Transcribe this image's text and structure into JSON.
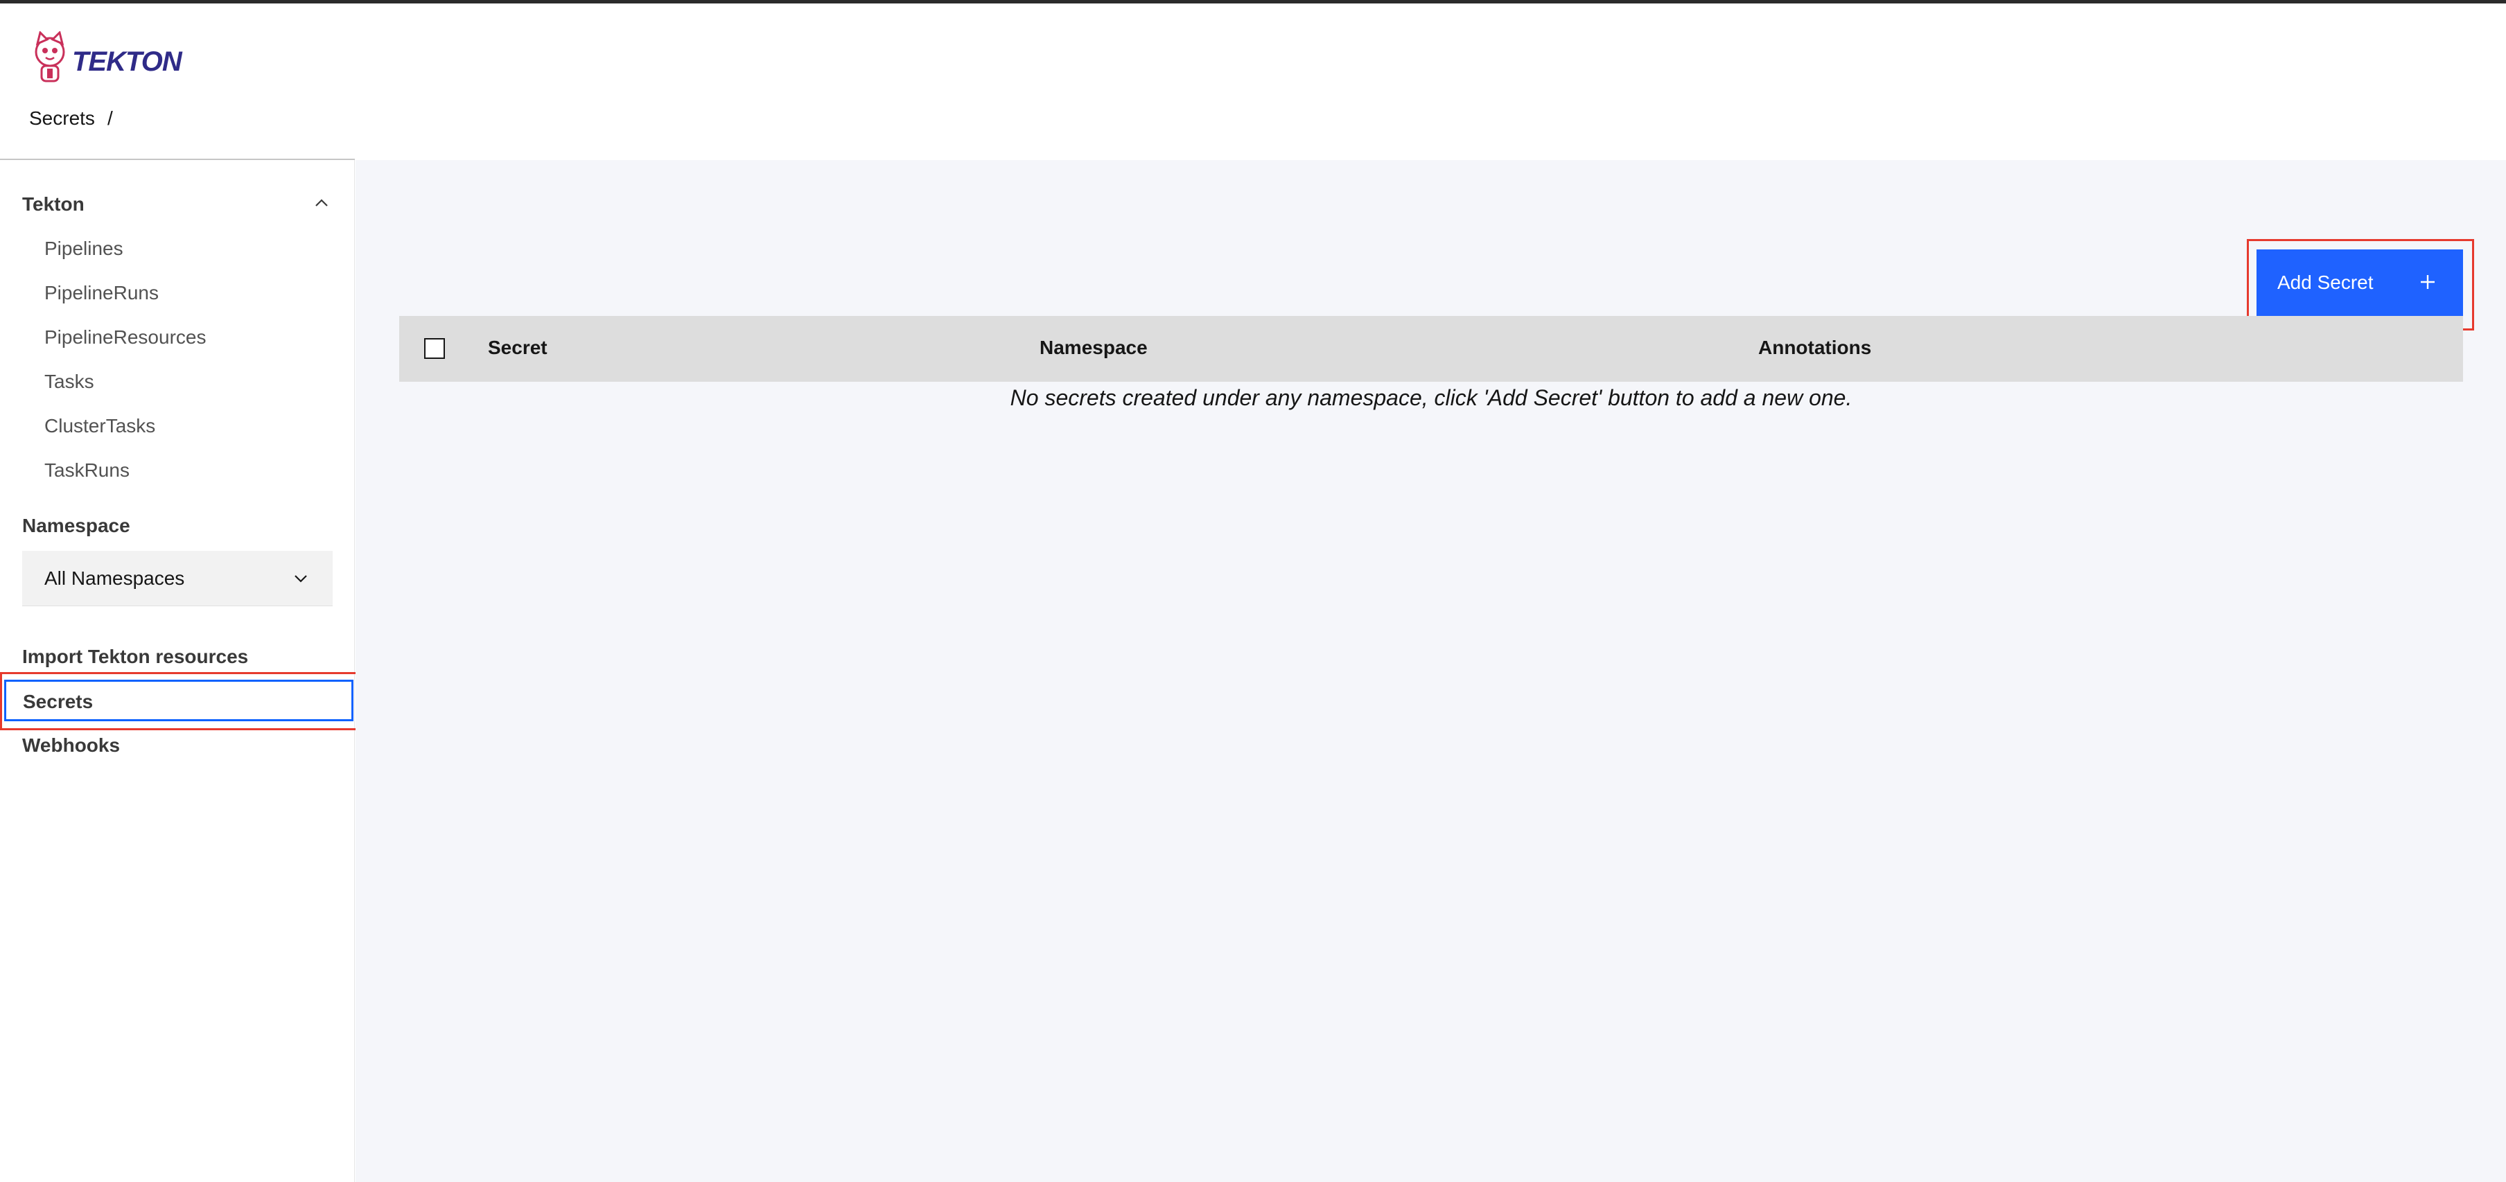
{
  "app": {
    "logo_text": "TEKTON",
    "logo_icon": "tekton-cat-icon"
  },
  "breadcrumb": {
    "current": "Secrets",
    "separator": "/"
  },
  "sidebar": {
    "tekton_section": {
      "title": "Tekton",
      "toggle_icon": "chevron-up-icon",
      "items": [
        {
          "label": "Pipelines"
        },
        {
          "label": "PipelineRuns"
        },
        {
          "label": "PipelineResources"
        },
        {
          "label": "Tasks"
        },
        {
          "label": "ClusterTasks"
        },
        {
          "label": "TaskRuns"
        }
      ]
    },
    "namespace": {
      "title": "Namespace",
      "selected": "All Namespaces",
      "icon": "chevron-down-icon"
    },
    "links": [
      {
        "label": "Import Tekton resources"
      },
      {
        "label": "Secrets",
        "active": true
      },
      {
        "label": "Webhooks"
      }
    ]
  },
  "main": {
    "add_button": {
      "label": "Add Secret",
      "icon": "plus-icon",
      "color": "#1f62ff"
    },
    "table": {
      "columns": [
        "Secret",
        "Namespace",
        "Annotations"
      ],
      "empty_message": "No secrets created under any namespace, click 'Add Secret' button to add a new one."
    }
  },
  "colors": {
    "annotation_red": "#e63a2e",
    "focus_blue": "#0f62fe",
    "table_header_bg": "#dddddd",
    "content_bg": "#f5f6fa"
  }
}
